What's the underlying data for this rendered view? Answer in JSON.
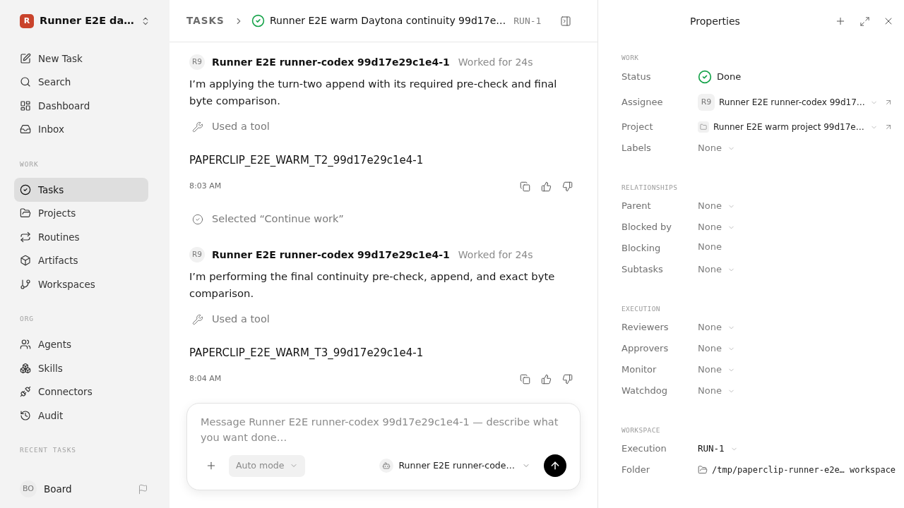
{
  "sidebar": {
    "logo_letter": "R",
    "workspace_name": "Runner E2E da…",
    "nav": [
      {
        "label": "New Task",
        "selected": false
      },
      {
        "label": "Search",
        "selected": false
      },
      {
        "label": "Dashboard",
        "selected": false
      },
      {
        "label": "Inbox",
        "selected": false
      }
    ],
    "sections": [
      {
        "title": "WORK",
        "items": [
          {
            "label": "Tasks",
            "selected": true
          },
          {
            "label": "Projects",
            "selected": false
          },
          {
            "label": "Routines",
            "selected": false
          },
          {
            "label": "Artifacts",
            "selected": false
          },
          {
            "label": "Workspaces",
            "selected": false
          }
        ]
      },
      {
        "title": "ORG",
        "items": [
          {
            "label": "Agents",
            "selected": false
          },
          {
            "label": "Skills",
            "selected": false
          },
          {
            "label": "Connectors",
            "selected": false
          },
          {
            "label": "Audit",
            "selected": false
          }
        ]
      },
      {
        "title": "RECENT TASKS"
      }
    ],
    "user": {
      "initials": "BO",
      "name": "Board"
    }
  },
  "header": {
    "section": "TASKS",
    "completed": true,
    "title": "Runner E2E warm Daytona continuity 99d17e…",
    "run_id": "RUN-1"
  },
  "thread": [
    {
      "kind": "message",
      "avatar": "R9",
      "author": "Runner E2E runner-codex 99d17e29c1e4-1",
      "duration": "Worked for 24s",
      "text": "I’m applying the turn-two append with its required pre-check and final byte comparison.",
      "tool": "Used a tool",
      "output": "PAPERCLIP_E2E_WARM_T2_99d17e29c1e4-1",
      "time": "8:03 AM"
    },
    {
      "kind": "event",
      "text": "Selected “Continue work”"
    },
    {
      "kind": "message",
      "avatar": "R9",
      "author": "Runner E2E runner-codex 99d17e29c1e4-1",
      "duration": "Worked for 24s",
      "text": "I’m performing the final continuity pre-check, append, and exact byte comparison.",
      "tool": "Used a tool",
      "output": "PAPERCLIP_E2E_WARM_T3_99d17e29c1e4-1",
      "time": "8:04 AM"
    }
  ],
  "composer": {
    "placeholder": "Message Runner E2E runner-codex 99d17e29c1e4-1 — describe what you want done…",
    "mode": "Auto mode",
    "agent": "Runner E2E runner-code…"
  },
  "properties": {
    "title": "Properties",
    "sections": [
      {
        "title": "WORK",
        "rows": [
          {
            "label": "Status",
            "kind": "status",
            "completed": true,
            "value": "Done"
          },
          {
            "label": "Assignee",
            "kind": "agent",
            "avatar": "R9",
            "value": "Runner E2E runner-codex 99d17…"
          },
          {
            "label": "Project",
            "kind": "project",
            "value": "Runner E2E warm project 99d17e…"
          },
          {
            "label": "Labels",
            "kind": "select",
            "value": "None"
          }
        ]
      },
      {
        "title": "RELATIONSHIPS",
        "rows": [
          {
            "label": "Parent",
            "kind": "select",
            "value": "None"
          },
          {
            "label": "Blocked by",
            "kind": "select",
            "value": "None"
          },
          {
            "label": "Blocking",
            "kind": "text",
            "value": "None"
          },
          {
            "label": "Subtasks",
            "kind": "select",
            "value": "None"
          }
        ]
      },
      {
        "title": "EXECUTION",
        "rows": [
          {
            "label": "Reviewers",
            "kind": "select",
            "value": "None"
          },
          {
            "label": "Approvers",
            "kind": "select",
            "value": "None"
          },
          {
            "label": "Monitor",
            "kind": "select",
            "value": "None"
          },
          {
            "label": "Watchdog",
            "kind": "select",
            "value": "None"
          }
        ]
      },
      {
        "title": "WORKSPACE",
        "rows": [
          {
            "label": "Execution",
            "kind": "run",
            "value": "RUN-1"
          },
          {
            "label": "Folder",
            "kind": "path",
            "value": "/tmp/paperclip-runner-e2e… workspace"
          }
        ]
      }
    ]
  }
}
